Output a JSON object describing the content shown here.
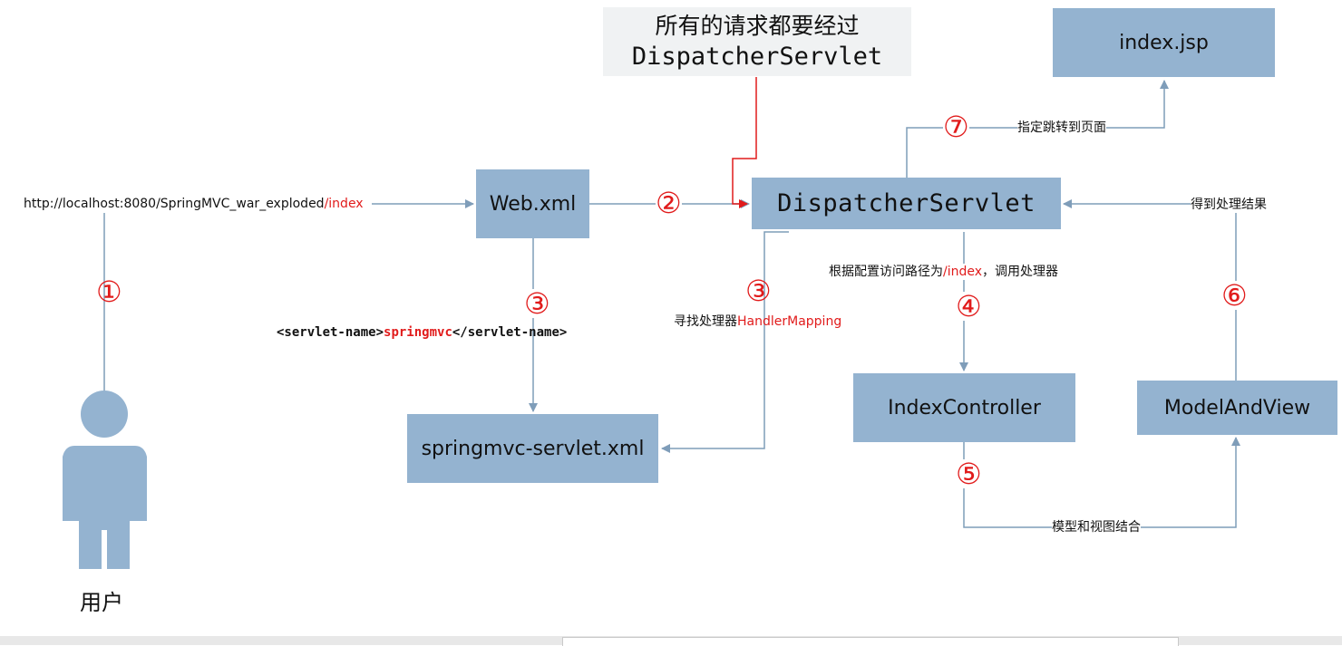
{
  "callout": {
    "line1": "所有的请求都要经过",
    "line2": "DispatcherServlet"
  },
  "nodes": {
    "index_jsp": "index.jsp",
    "web_xml": "Web.xml",
    "dispatcher": "DispatcherServlet",
    "springmvc_servlet_xml": "springmvc-servlet.xml",
    "index_controller": "IndexController",
    "model_and_view": "ModelAndView",
    "user": "用户"
  },
  "labels": {
    "url_prefix": "http://localhost:8080/SpringMVC_war_exploded",
    "url_path": "/index",
    "servlet_name_open": "<servlet-name>",
    "servlet_name_value": "springmvc",
    "servlet_name_close": "</servlet-name>",
    "find_handler": "寻找处理器",
    "handler_mapping": "HandlerMapping",
    "route_prefix": "根据配置访问路径为",
    "route_path": "/index",
    "route_suffix": "，调用处理器",
    "get_result": "得到处理结果",
    "jump_page": "指定跳转到页面",
    "combine": "模型和视图结合"
  },
  "steps": {
    "s1": "①",
    "s2": "②",
    "s3a": "③",
    "s3b": "③",
    "s4": "④",
    "s5": "⑤",
    "s6": "⑥",
    "s7": "⑦"
  },
  "colors": {
    "box": "#94b3d0",
    "arrow": "#7f9db9",
    "highlight": "#e11b1b"
  }
}
